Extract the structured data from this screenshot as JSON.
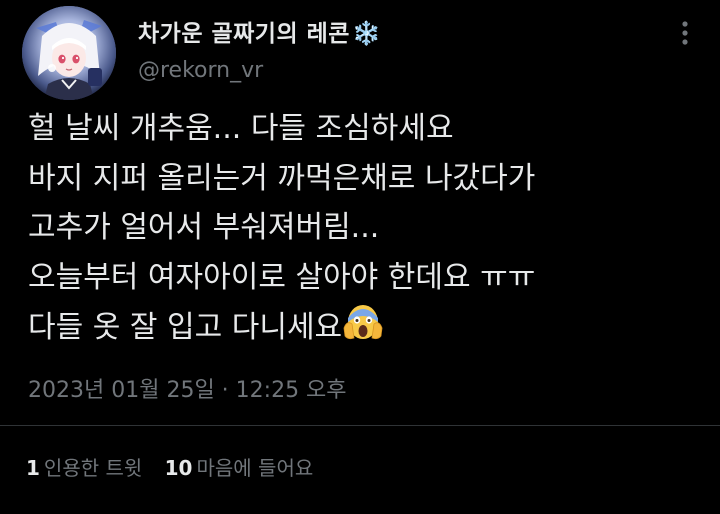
{
  "author": {
    "display_name": "차가운 골짜기의 레콘",
    "name_emoji": "❄️",
    "handle": "@rekorn_vr"
  },
  "tweet": {
    "lines": [
      "헐 날씨 개추움... 다들 조심하세요",
      "바지 지퍼 올리는거 까먹은채로 나갔다가",
      "고추가 얼어서 부숴져버림...",
      "오늘부터 여자아이로 살아야 한데요 ㅠㅠ",
      "다들 옷 잘 입고 다니세요"
    ],
    "timestamp": "2023년 01월 25일 · 12:25 오후"
  },
  "stats": {
    "quote_count": "1",
    "quote_label": "인용한 트윗",
    "like_count": "10",
    "like_label": "마음에 들어요"
  },
  "icons": {
    "more": "more-dots-icon",
    "emoji": "screaming-face-icon"
  },
  "colors": {
    "background": "#000000",
    "primary_text": "#e7e9ea",
    "secondary_text": "#71767b",
    "divider": "#2f3336"
  }
}
